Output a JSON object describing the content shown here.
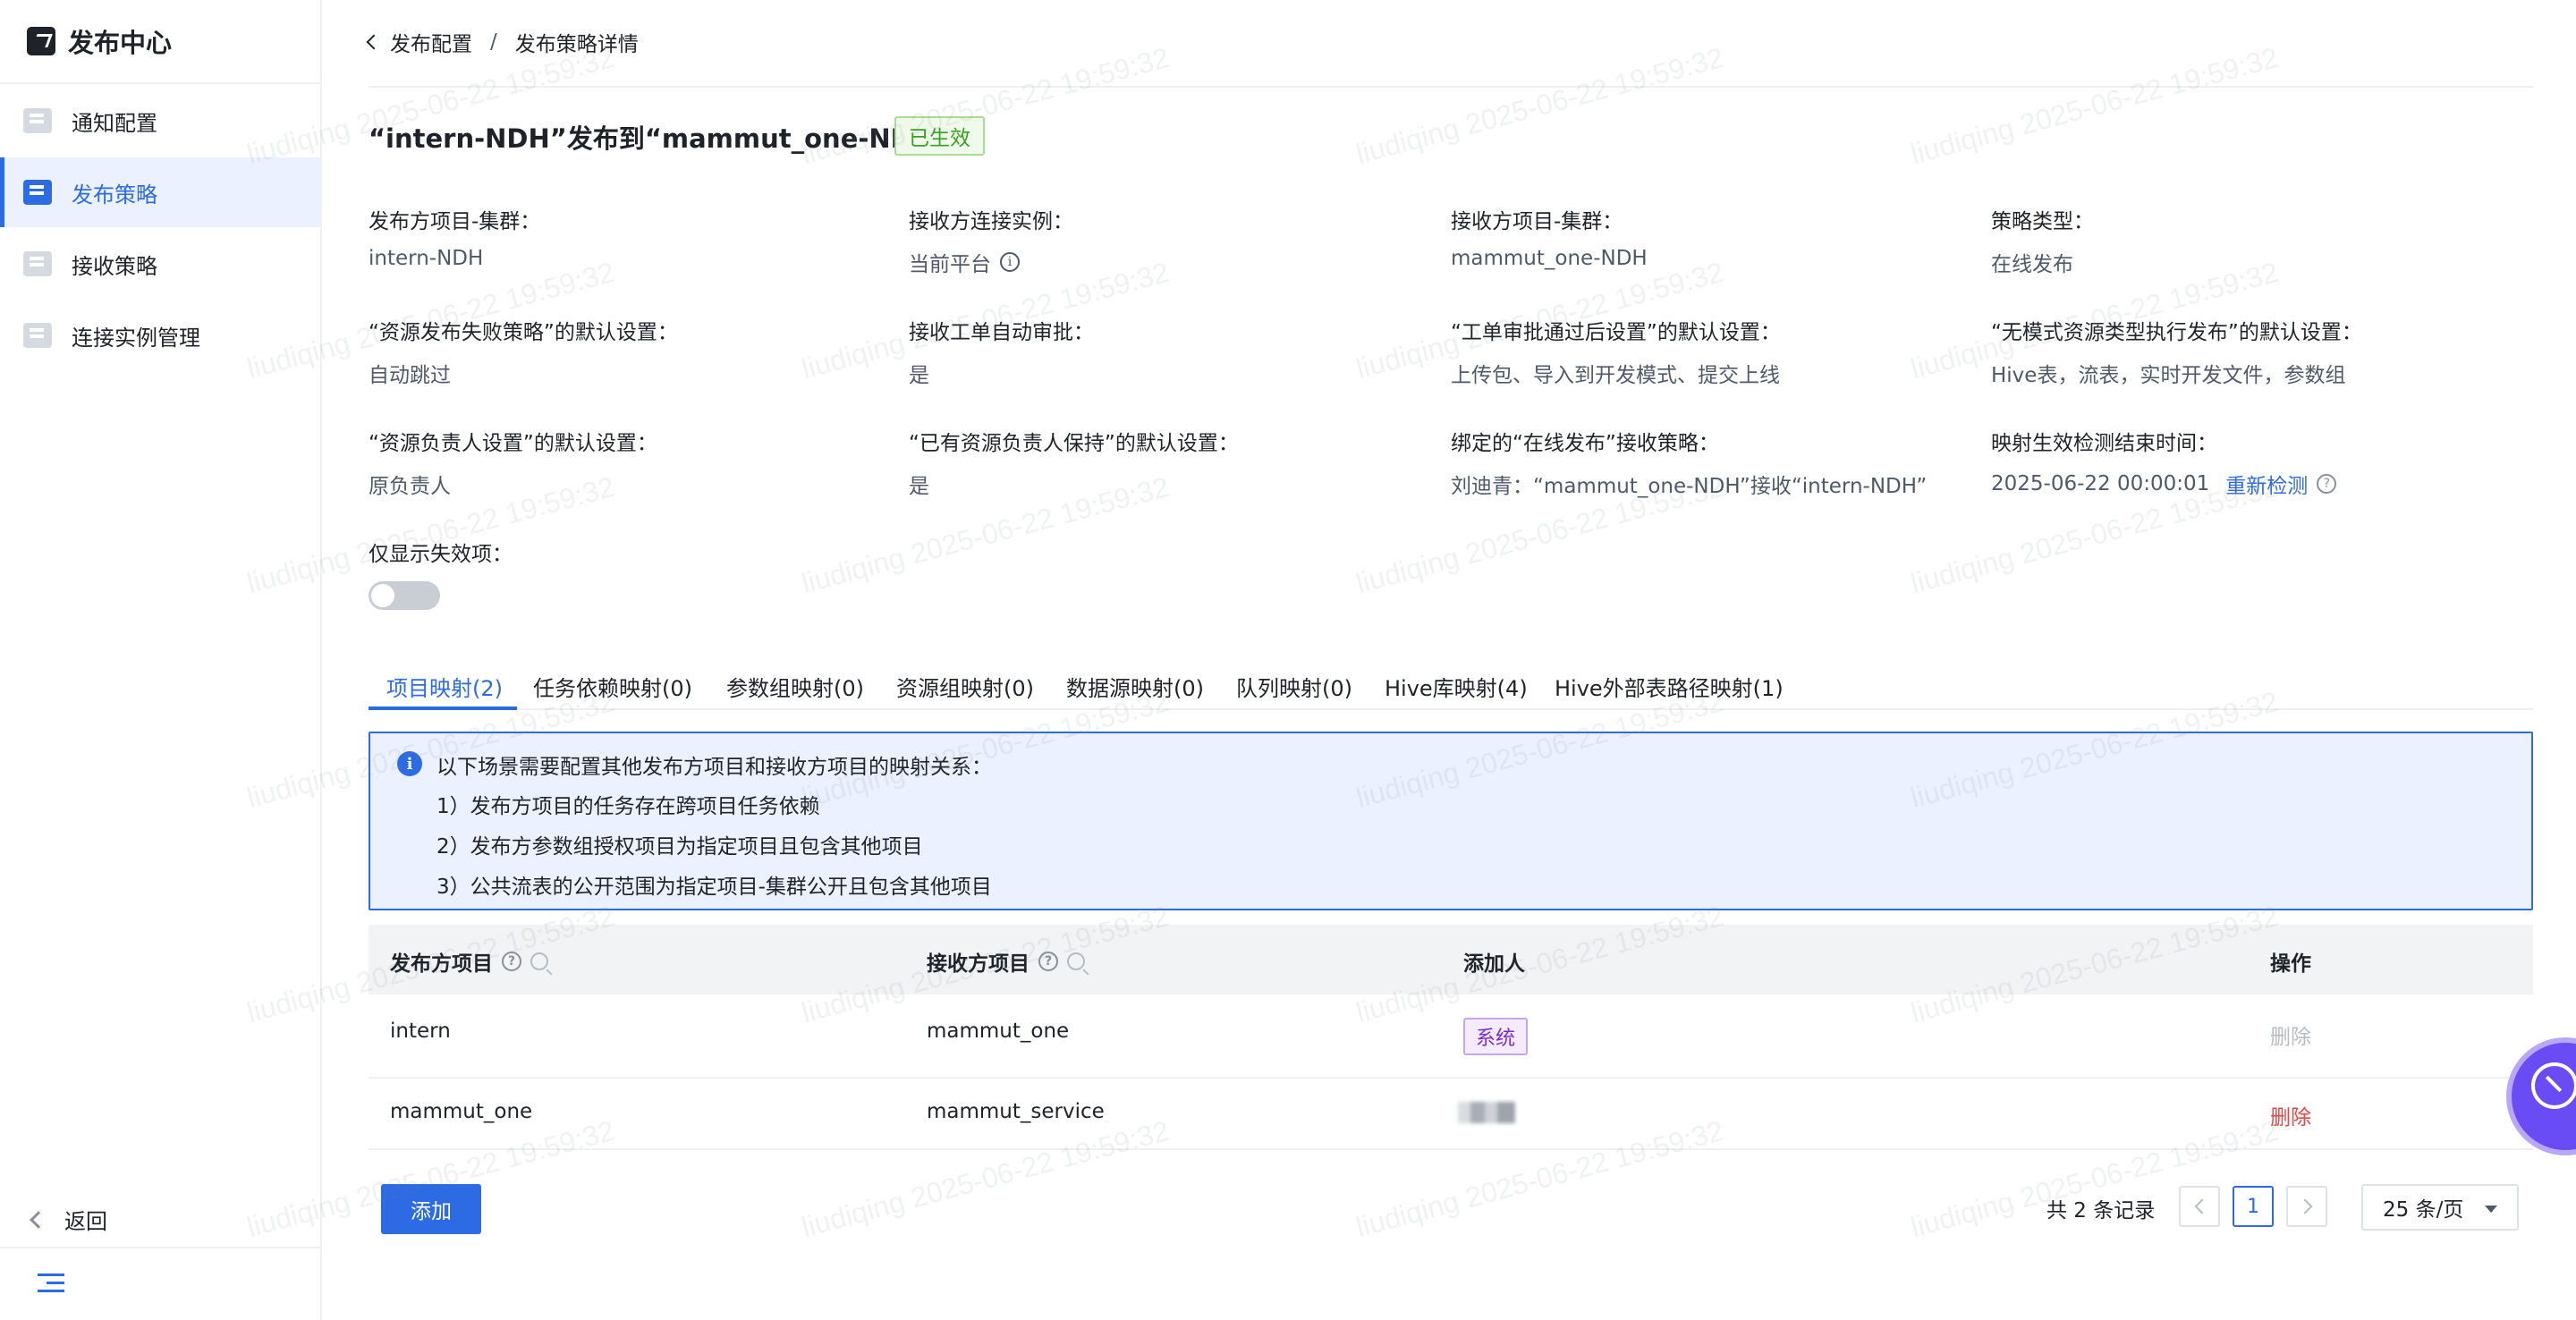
{
  "sidebar": {
    "brand_title": "发布中心",
    "items": [
      {
        "label": "通知配置",
        "icon": "notification-config-icon"
      },
      {
        "label": "发布策略",
        "icon": "publish-strategy-icon",
        "active": true
      },
      {
        "label": "接收策略",
        "icon": "receive-strategy-icon"
      },
      {
        "label": "连接实例管理",
        "icon": "connection-instance-icon"
      }
    ],
    "back_label": "返回"
  },
  "breadcrumb": {
    "parent": "发布配置",
    "separator": "/",
    "current": "发布策略详情"
  },
  "header": {
    "title": "“intern-NDH”发布到“mammut_one-NDH”",
    "status_badge": "已生效"
  },
  "fields": {
    "publisher_project": {
      "label": "发布方项目-集群：",
      "value": "intern-NDH"
    },
    "receiver_connection": {
      "label": "接收方连接实例：",
      "value": "当前平台"
    },
    "receiver_project": {
      "label": "接收方项目-集群：",
      "value": "mammut_one-NDH"
    },
    "strategy_type": {
      "label": "策略类型：",
      "value": "在线发布"
    },
    "failure_strategy": {
      "label": "“资源发布失败策略”的默认设置：",
      "value": "自动跳过"
    },
    "auto_approve": {
      "label": "接收工单自动审批：",
      "value": "是"
    },
    "after_approval": {
      "label": "“工单审批通过后设置”的默认设置：",
      "value": "上传包、导入到开发模式、提交上线"
    },
    "no_mode_resource": {
      "label": "“无模式资源类型执行发布”的默认设置：",
      "value": "Hive表，流表，实时开发文件，参数组"
    },
    "owner_setting": {
      "label": "“资源负责人设置”的默认设置：",
      "value": "原负责人"
    },
    "keep_owner": {
      "label": "“已有资源负责人保持”的默认设置：",
      "value": "是"
    },
    "bound_receive": {
      "label": "绑定的“在线发布”接收策略：",
      "value": "刘迪青：“mammut_one-NDH”接收“intern-NDH”"
    },
    "detect_end_time": {
      "label": "映射生效检测结束时间：",
      "value": "2025-06-22 00:00:01",
      "action": "重新检测"
    },
    "only_invalid": {
      "label": "仅显示失效项：",
      "enabled": false
    }
  },
  "tabs": [
    {
      "label": "项目映射(2)",
      "active": true
    },
    {
      "label": "任务依赖映射(0)"
    },
    {
      "label": "参数组映射(0)"
    },
    {
      "label": "资源组映射(0)"
    },
    {
      "label": "数据源映射(0)"
    },
    {
      "label": "队列映射(0)"
    },
    {
      "label": "Hive库映射(4)"
    },
    {
      "label": "Hive外部表路径映射(1)"
    }
  ],
  "notice": {
    "heading": "以下场景需要配置其他发布方项目和接收方项目的映射关系：",
    "lines": [
      "1）发布方项目的任务存在跨项目任务依赖",
      "2）发布方参数组授权项目为指定项目且包含其他项目",
      "3）公共流表的公开范围为指定项目-集群公开且包含其他项目"
    ]
  },
  "table": {
    "columns": [
      "发布方项目",
      "接收方项目",
      "添加人",
      "操作"
    ],
    "rows": [
      {
        "publisher": "intern",
        "receiver": "mammut_one",
        "adder_tag": "系统",
        "action": "删除",
        "action_enabled": false
      },
      {
        "publisher": "mammut_one",
        "receiver": "mammut_service",
        "adder_tag": "",
        "action": "删除",
        "action_enabled": true
      }
    ]
  },
  "add_button": "添加",
  "pagination": {
    "total_text": "共 2 条记录",
    "current_page": "1",
    "page_size": "25 条/页"
  },
  "watermark_text": "liudiqing 2025-06-22 19:59:32",
  "colors": {
    "accent": "#2d6be4",
    "success": "#3aa023",
    "danger": "#e54545",
    "tag_purple": "#7b2bd0"
  }
}
